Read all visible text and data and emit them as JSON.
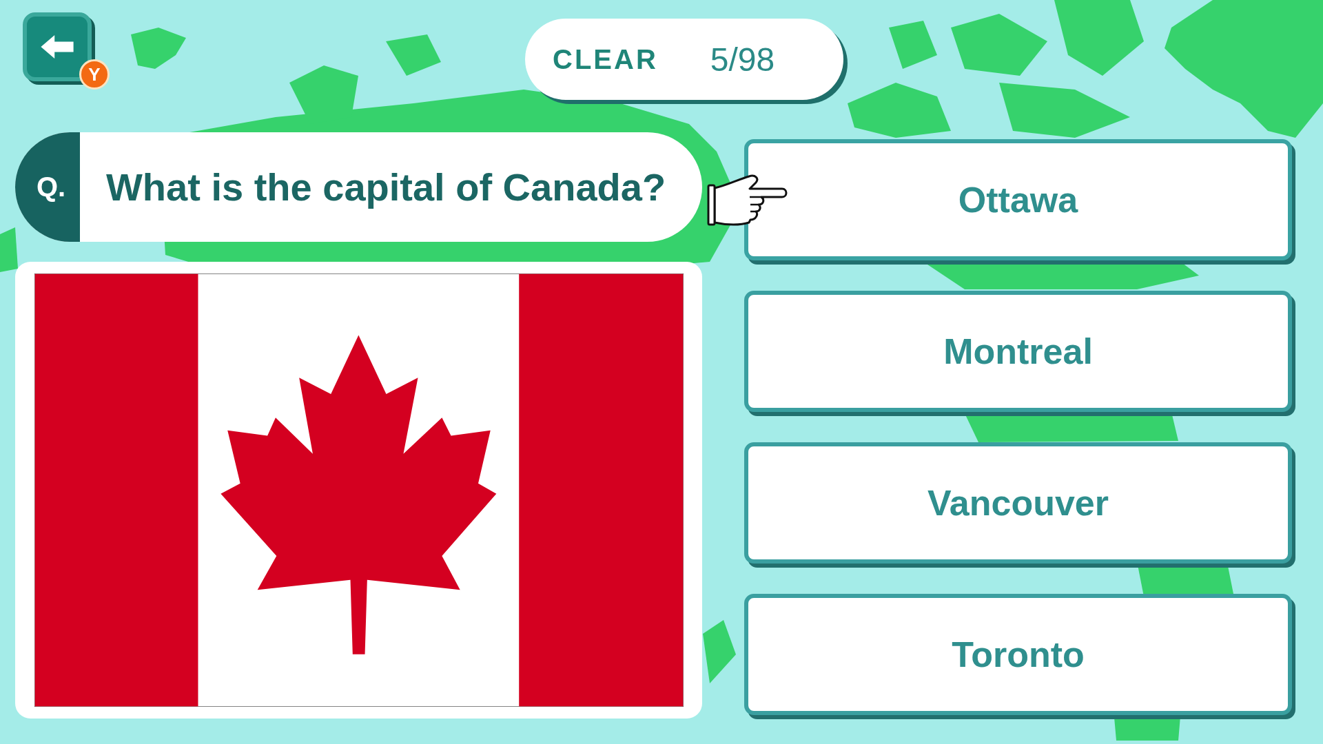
{
  "header": {
    "back_button": {
      "key_hint": "Y"
    },
    "progress": {
      "label": "CLEAR",
      "count": "5/98"
    }
  },
  "question": {
    "marker": "Q.",
    "text": "What is the capital of Canada?"
  },
  "answers": [
    {
      "label": "Ottawa",
      "selected": true
    },
    {
      "label": "Montreal",
      "selected": false
    },
    {
      "label": "Vancouver",
      "selected": false
    },
    {
      "label": "Toronto",
      "selected": false
    }
  ]
}
